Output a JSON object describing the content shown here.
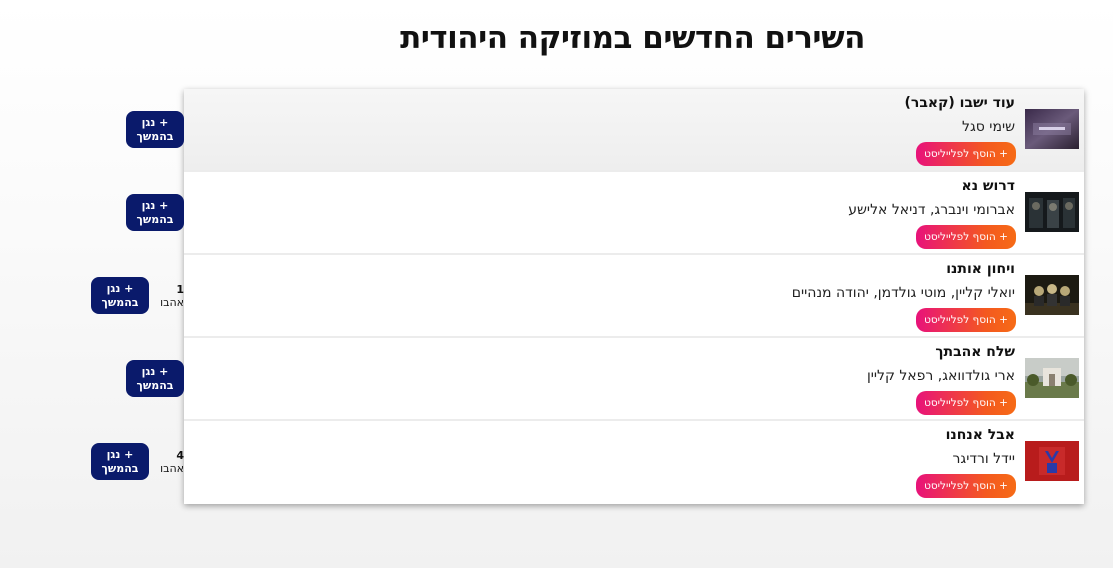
{
  "page": {
    "title": "השירים החדשים במוזיקה היהודית"
  },
  "colors": {
    "play_button": "#0a1a6b",
    "playlist_gradient_start": "#e8127a",
    "playlist_gradient_end": "#f66b16"
  },
  "songs": [
    {
      "title": "עוד ישבו (קאבר)",
      "artist": "שימי סגל",
      "add_label": "+ הוסף לפלייליסט",
      "play_label_1": "+ נגן",
      "play_label_2": "בהמשך",
      "likes": "",
      "likes_label": "",
      "thumbnail_icon": "purple-text-thumbnail",
      "active": true
    },
    {
      "title": "דרוש נא",
      "artist": "אברומי וינברג, דניאל אלישע",
      "add_label": "+ הוסף לפלייליסט",
      "play_label_1": "+ נגן",
      "play_label_2": "בהמשך",
      "likes": "",
      "likes_label": "",
      "thumbnail_icon": "dark-group-thumbnail",
      "active": false
    },
    {
      "title": "ויחון אותנו",
      "artist": "יואלי קליין, מוטי גולדמן, יהודה מנהיים",
      "add_label": "+ הוסף לפלייליסט",
      "play_label_1": "+ נגן",
      "play_label_2": "בהמשך",
      "likes": "1",
      "likes_label": "אהבו",
      "thumbnail_icon": "group-poster-thumbnail",
      "active": false
    },
    {
      "title": "שלח אהבתך",
      "artist": "ארי גולדוואג, רפאל קליין",
      "add_label": "+ הוסף לפלייליסט",
      "play_label_1": "+ נגן",
      "play_label_2": "בהמשך",
      "likes": "",
      "likes_label": "",
      "thumbnail_icon": "landscape-thumbnail",
      "active": false
    },
    {
      "title": "אבל אנחנו",
      "artist": "יידל ורדיגר",
      "add_label": "+ הוסף לפלייליסט",
      "play_label_1": "+ נגן",
      "play_label_2": "בהמשך",
      "likes": "4",
      "likes_label": "אהבו",
      "thumbnail_icon": "red-poster-thumbnail",
      "active": false
    }
  ]
}
